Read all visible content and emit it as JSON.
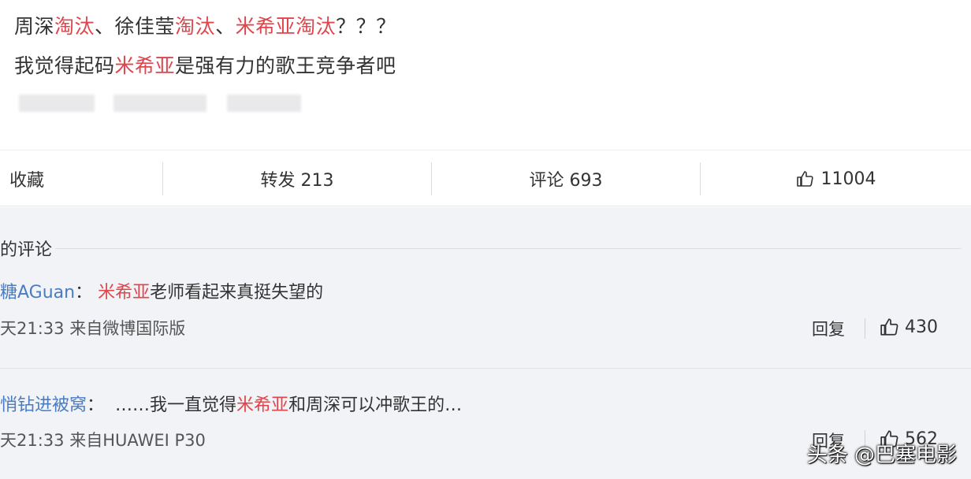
{
  "post": {
    "line1": [
      {
        "t": "周深",
        "hl": false
      },
      {
        "t": "淘汰",
        "hl": true
      },
      {
        "t": "、徐佳莹",
        "hl": false
      },
      {
        "t": "淘汰",
        "hl": true
      },
      {
        "t": "、",
        "hl": false
      },
      {
        "t": "米希亚淘汰",
        "hl": true
      },
      {
        "t": "？？？",
        "hl": false
      }
    ],
    "line2": [
      {
        "t": "我觉得起码",
        "hl": false
      },
      {
        "t": "米希亚",
        "hl": true
      },
      {
        "t": "是强有力的歌王竞争者吧",
        "hl": false
      }
    ]
  },
  "actions": {
    "favorite": "收藏",
    "forward": "转发 213",
    "comment": "评论 693",
    "like": "11004"
  },
  "comments": {
    "title": "的评论",
    "items": [
      {
        "user": "糖AGuan",
        "sep": "：",
        "text": [
          {
            "t": "米希亚",
            "hl": true
          },
          {
            "t": "老师看起来真挺失望的",
            "hl": false
          }
        ],
        "meta": "天21:33 来自微博国际版",
        "reply": "回复",
        "likes": "430"
      },
      {
        "user": "悄钻进被窝",
        "sep": "：",
        "text": [
          {
            "t": "……我一直觉得",
            "hl": false
          },
          {
            "t": "米希亚",
            "hl": true
          },
          {
            "t": "和周深可以冲歌王的…",
            "hl": false
          }
        ],
        "meta": "天21:33 来自HUAWEI P30",
        "reply": "回复",
        "likes": "562"
      }
    ]
  },
  "watermark": "头条 @巴塞电影",
  "colors": {
    "highlight": "#e0454b",
    "username": "#4a7cc2",
    "comment_bg": "#f2f3f6"
  },
  "icons": {
    "like": "thumbs-up-icon"
  }
}
